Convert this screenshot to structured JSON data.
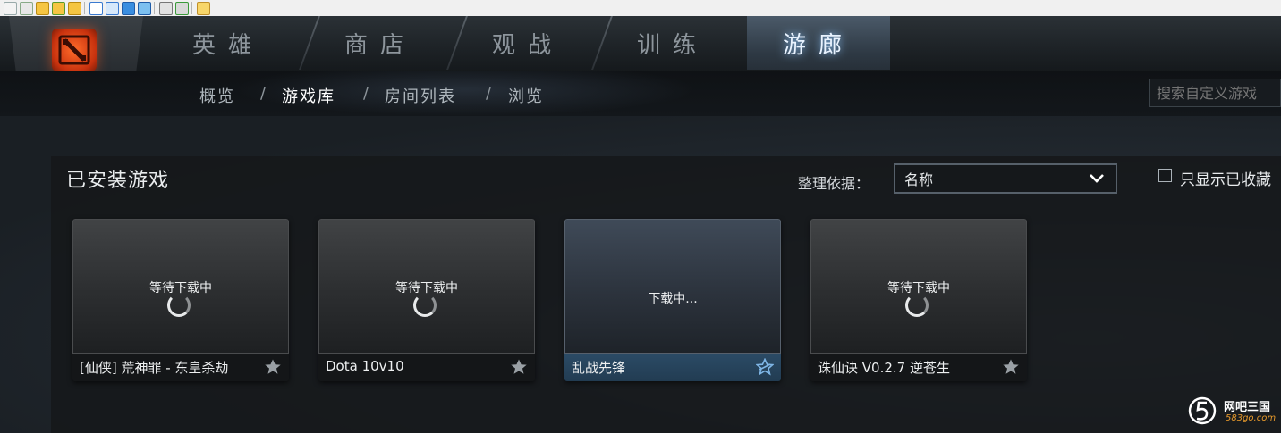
{
  "nav": {
    "tabs": [
      {
        "label": "英雄"
      },
      {
        "label": "商店"
      },
      {
        "label": "观战"
      },
      {
        "label": "训练"
      },
      {
        "label": "游廊",
        "active": true
      }
    ]
  },
  "subnav": {
    "items": [
      {
        "label": "概览"
      },
      {
        "label": "游戏库",
        "active": true
      },
      {
        "label": "房间列表"
      },
      {
        "label": "浏览"
      }
    ],
    "separator": "/"
  },
  "search": {
    "placeholder": "搜索自定义游戏"
  },
  "section": {
    "title": "已安装游戏"
  },
  "sort": {
    "label": "整理依据：",
    "value": "名称"
  },
  "favorites_filter": {
    "label": "只显示已收藏",
    "checked": false
  },
  "games": [
    {
      "name": "[仙侠] 荒神罪 - 东皇杀劫",
      "status": "等待下载中",
      "spinner": true,
      "selected": false,
      "starred": false
    },
    {
      "name": "Dota 10v10",
      "status": "等待下载中",
      "spinner": true,
      "selected": false,
      "starred": false
    },
    {
      "name": "乱战先锋",
      "status": "下载中...",
      "spinner": false,
      "selected": true,
      "starred": true
    },
    {
      "name": "诛仙诀 V0.2.7 逆苍生",
      "status": "等待下载中",
      "spinner": true,
      "selected": false,
      "starred": false
    }
  ],
  "watermark": {
    "text": "网吧三国",
    "url": "583go.com"
  },
  "colors": {
    "accent": "#8ec7ff",
    "logo": "#e0461a",
    "selected_bar": "#2b4b66"
  },
  "icons": [
    "dota-logo-icon",
    "chevron-down-icon",
    "star-icon",
    "starred-icon",
    "spinner-icon"
  ]
}
